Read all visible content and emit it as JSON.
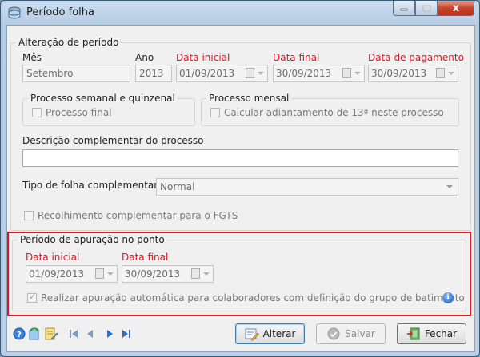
{
  "window": {
    "title": "Período folha",
    "close_label": "x"
  },
  "periodo": {
    "group_title": "Alteração de período",
    "mes_label": "Mês",
    "mes_value": "Setembro",
    "ano_label": "Ano",
    "ano_value": "2013",
    "data_inicial_label": "Data inicial",
    "data_inicial_value": "01/09/2013",
    "data_final_label": "Data final",
    "data_final_value": "30/09/2013",
    "data_pagamento_label": "Data de pagamento",
    "data_pagamento_value": "30/09/2013"
  },
  "semanal": {
    "group_title": "Processo semanal e quinzenal",
    "check_label": "Processo final"
  },
  "mensal": {
    "group_title": "Processo mensal",
    "check_label": "Calcular adiantamento de 13ª neste processo"
  },
  "descricao": {
    "label": "Descrição complementar do processo",
    "value": ""
  },
  "tipo": {
    "label": "Tipo de folha complementar",
    "value": "Normal"
  },
  "fgts": {
    "check_label": "Recolhimento complementar para o FGTS"
  },
  "apuracao": {
    "group_title": "Período de apuração no ponto",
    "data_inicial_label": "Data inicial",
    "data_inicial_value": "01/09/2013",
    "data_final_label": "Data final",
    "data_final_value": "30/09/2013",
    "check_label": "Realizar apuração automática para colaboradores com definição do grupo de batimento",
    "info": "i"
  },
  "buttons": {
    "alterar": "Alterar",
    "salvar": "Salvar",
    "fechar": "Fechar"
  },
  "colors": {
    "required": "#e0141e",
    "highlight": "#e0141e"
  }
}
